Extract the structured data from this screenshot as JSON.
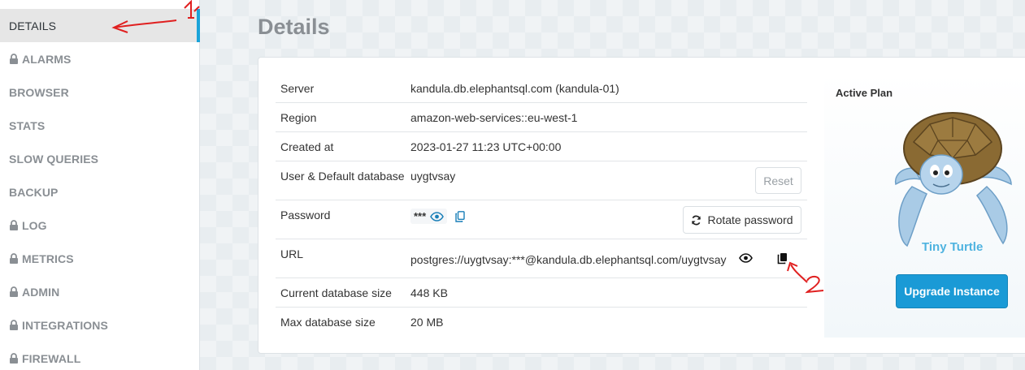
{
  "sidebar": {
    "items": [
      {
        "label": "DETAILS",
        "locked": false,
        "active": true
      },
      {
        "label": "ALARMS",
        "locked": true
      },
      {
        "label": "BROWSER",
        "locked": false
      },
      {
        "label": "STATS",
        "locked": false
      },
      {
        "label": "SLOW QUERIES",
        "locked": false
      },
      {
        "label": "BACKUP",
        "locked": false
      },
      {
        "label": "LOG",
        "locked": true
      },
      {
        "label": "METRICS",
        "locked": true
      },
      {
        "label": "ADMIN",
        "locked": true
      },
      {
        "label": "INTEGRATIONS",
        "locked": true
      },
      {
        "label": "FIREWALL",
        "locked": true
      }
    ]
  },
  "page": {
    "title": "Details"
  },
  "details": {
    "server": {
      "label": "Server",
      "value": "kandula.db.elephantsql.com (kandula-01)"
    },
    "region": {
      "label": "Region",
      "value": "amazon-web-services::eu-west-1"
    },
    "created": {
      "label": "Created at",
      "value": "2023-01-27 11:23 UTC+00:00"
    },
    "user": {
      "label": "User & Default database",
      "value": "uygtvsay",
      "reset_label": "Reset"
    },
    "password": {
      "label": "Password",
      "masked": "***",
      "rotate_label": "Rotate password"
    },
    "url": {
      "label": "URL",
      "value": "postgres://uygtvsay:***@kandula.db.elephantsql.com/uygtvsay"
    },
    "current_size": {
      "label": "Current database size",
      "value": "448 KB"
    },
    "max_size": {
      "label": "Max database size",
      "value": "20 MB"
    }
  },
  "plan": {
    "title": "Active Plan",
    "name": "Tiny Turtle",
    "upgrade_label": "Upgrade Instance"
  },
  "annotations": {
    "one": "1",
    "two": "2"
  },
  "colors": {
    "accent": "#1aa3d9",
    "button": "#1a9ad6",
    "plan_name": "#4fb3e0",
    "annotation": "#e02020"
  }
}
